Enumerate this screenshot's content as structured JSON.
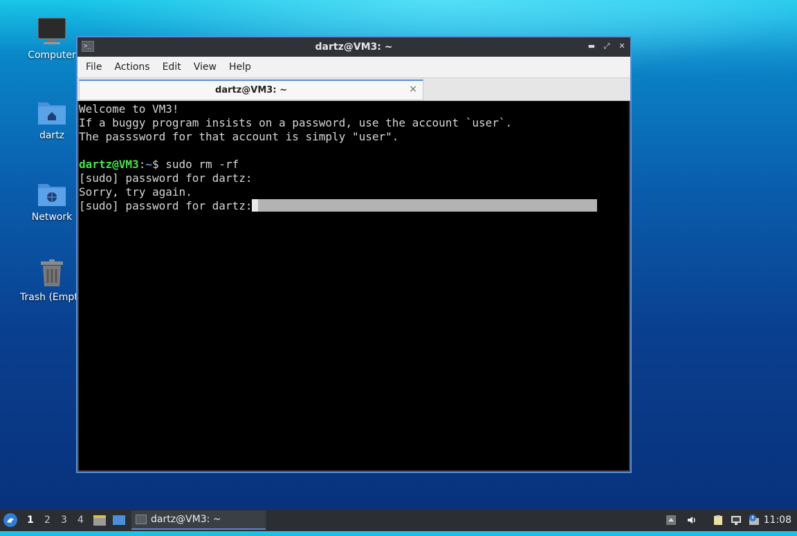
{
  "desktop": {
    "icons": [
      {
        "label": "Computer"
      },
      {
        "label": "dartz"
      },
      {
        "label": "Network"
      },
      {
        "label": "Trash (Empt"
      }
    ]
  },
  "window": {
    "title": "dartz@VM3: ~",
    "menu": [
      "File",
      "Actions",
      "Edit",
      "View",
      "Help"
    ],
    "tab_label": "dartz@VM3: ~",
    "tab_close": "×"
  },
  "terminal": {
    "welcome": "Welcome to VM3!",
    "line2": "If a buggy program insists on a password, use the account `user`.",
    "line3": "The passsword for that account is simply \"user\".",
    "prompt_user": "dartz@VM3",
    "prompt_sep": ":",
    "prompt_path": "~",
    "prompt_dollar": "$ ",
    "command": "sudo rm -rf",
    "sudo1": "[sudo] password for dartz:",
    "sorry": "Sorry, try again.",
    "sudo2": "[sudo] password for dartz:"
  },
  "taskbar": {
    "workspaces": [
      "1",
      "2",
      "3",
      "4"
    ],
    "active_workspace": "1",
    "task_label": "dartz@VM3: ~",
    "clock": "11:08"
  },
  "colors": {
    "accent": "#5a8fd6",
    "prompt_green": "#4ee14e",
    "prompt_blue": "#5f8fe6"
  }
}
